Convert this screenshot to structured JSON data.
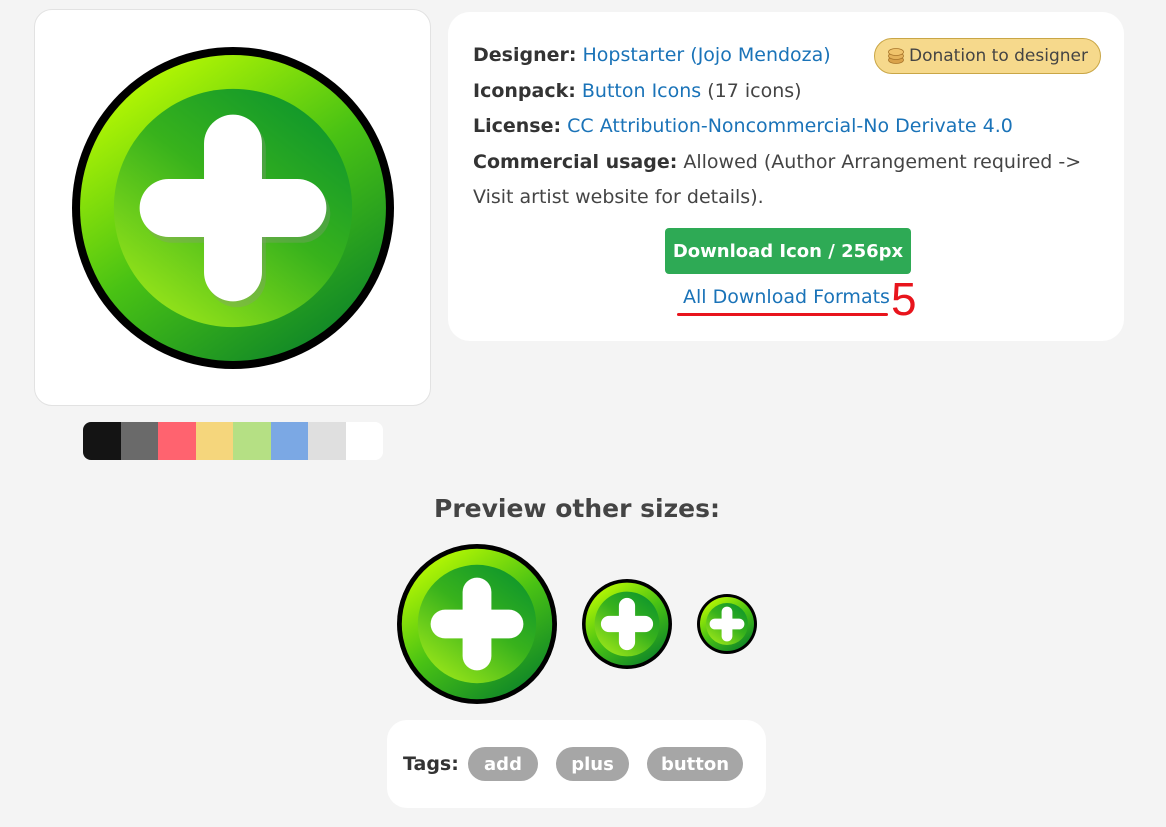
{
  "icon": {
    "name": "add-icon",
    "colors": {
      "ring": "#000000",
      "light_green": "#c5ff00",
      "mid_green": "#5ecb16",
      "dark_green": "#0c8a2c",
      "plus": "#ffffff"
    }
  },
  "palette": [
    "#141414",
    "#6a6a6a",
    "#ff636f",
    "#f5d67c",
    "#b5e084",
    "#7ba8e4",
    "#dfdfdf",
    "#ffffff"
  ],
  "details": {
    "designer_label": "Designer:",
    "designer_name": "Hopstarter (Jojo Mendoza)",
    "iconpack_label": "Iconpack:",
    "iconpack_name": "Button Icons",
    "iconpack_count": "(17 icons)",
    "license_label": "License:",
    "license_name": "CC Attribution-Noncommercial-No Derivate 4.0",
    "commercial_label": "Commercial usage:",
    "commercial_text_1": "Allowed (Author Arrangement required ->",
    "commercial_text_2": "Visit artist website for details)."
  },
  "donation": {
    "icon": "coin-stack-icon",
    "label": "Donation to designer"
  },
  "download": {
    "button_label": "Download Icon / 256px",
    "all_formats_label": "All Download Formats"
  },
  "annotation": {
    "number": "5",
    "color": "#e8141c"
  },
  "preview": {
    "heading": "Preview other sizes:"
  },
  "tags": {
    "label": "Tags:",
    "items": [
      "add",
      "plus",
      "button"
    ]
  }
}
